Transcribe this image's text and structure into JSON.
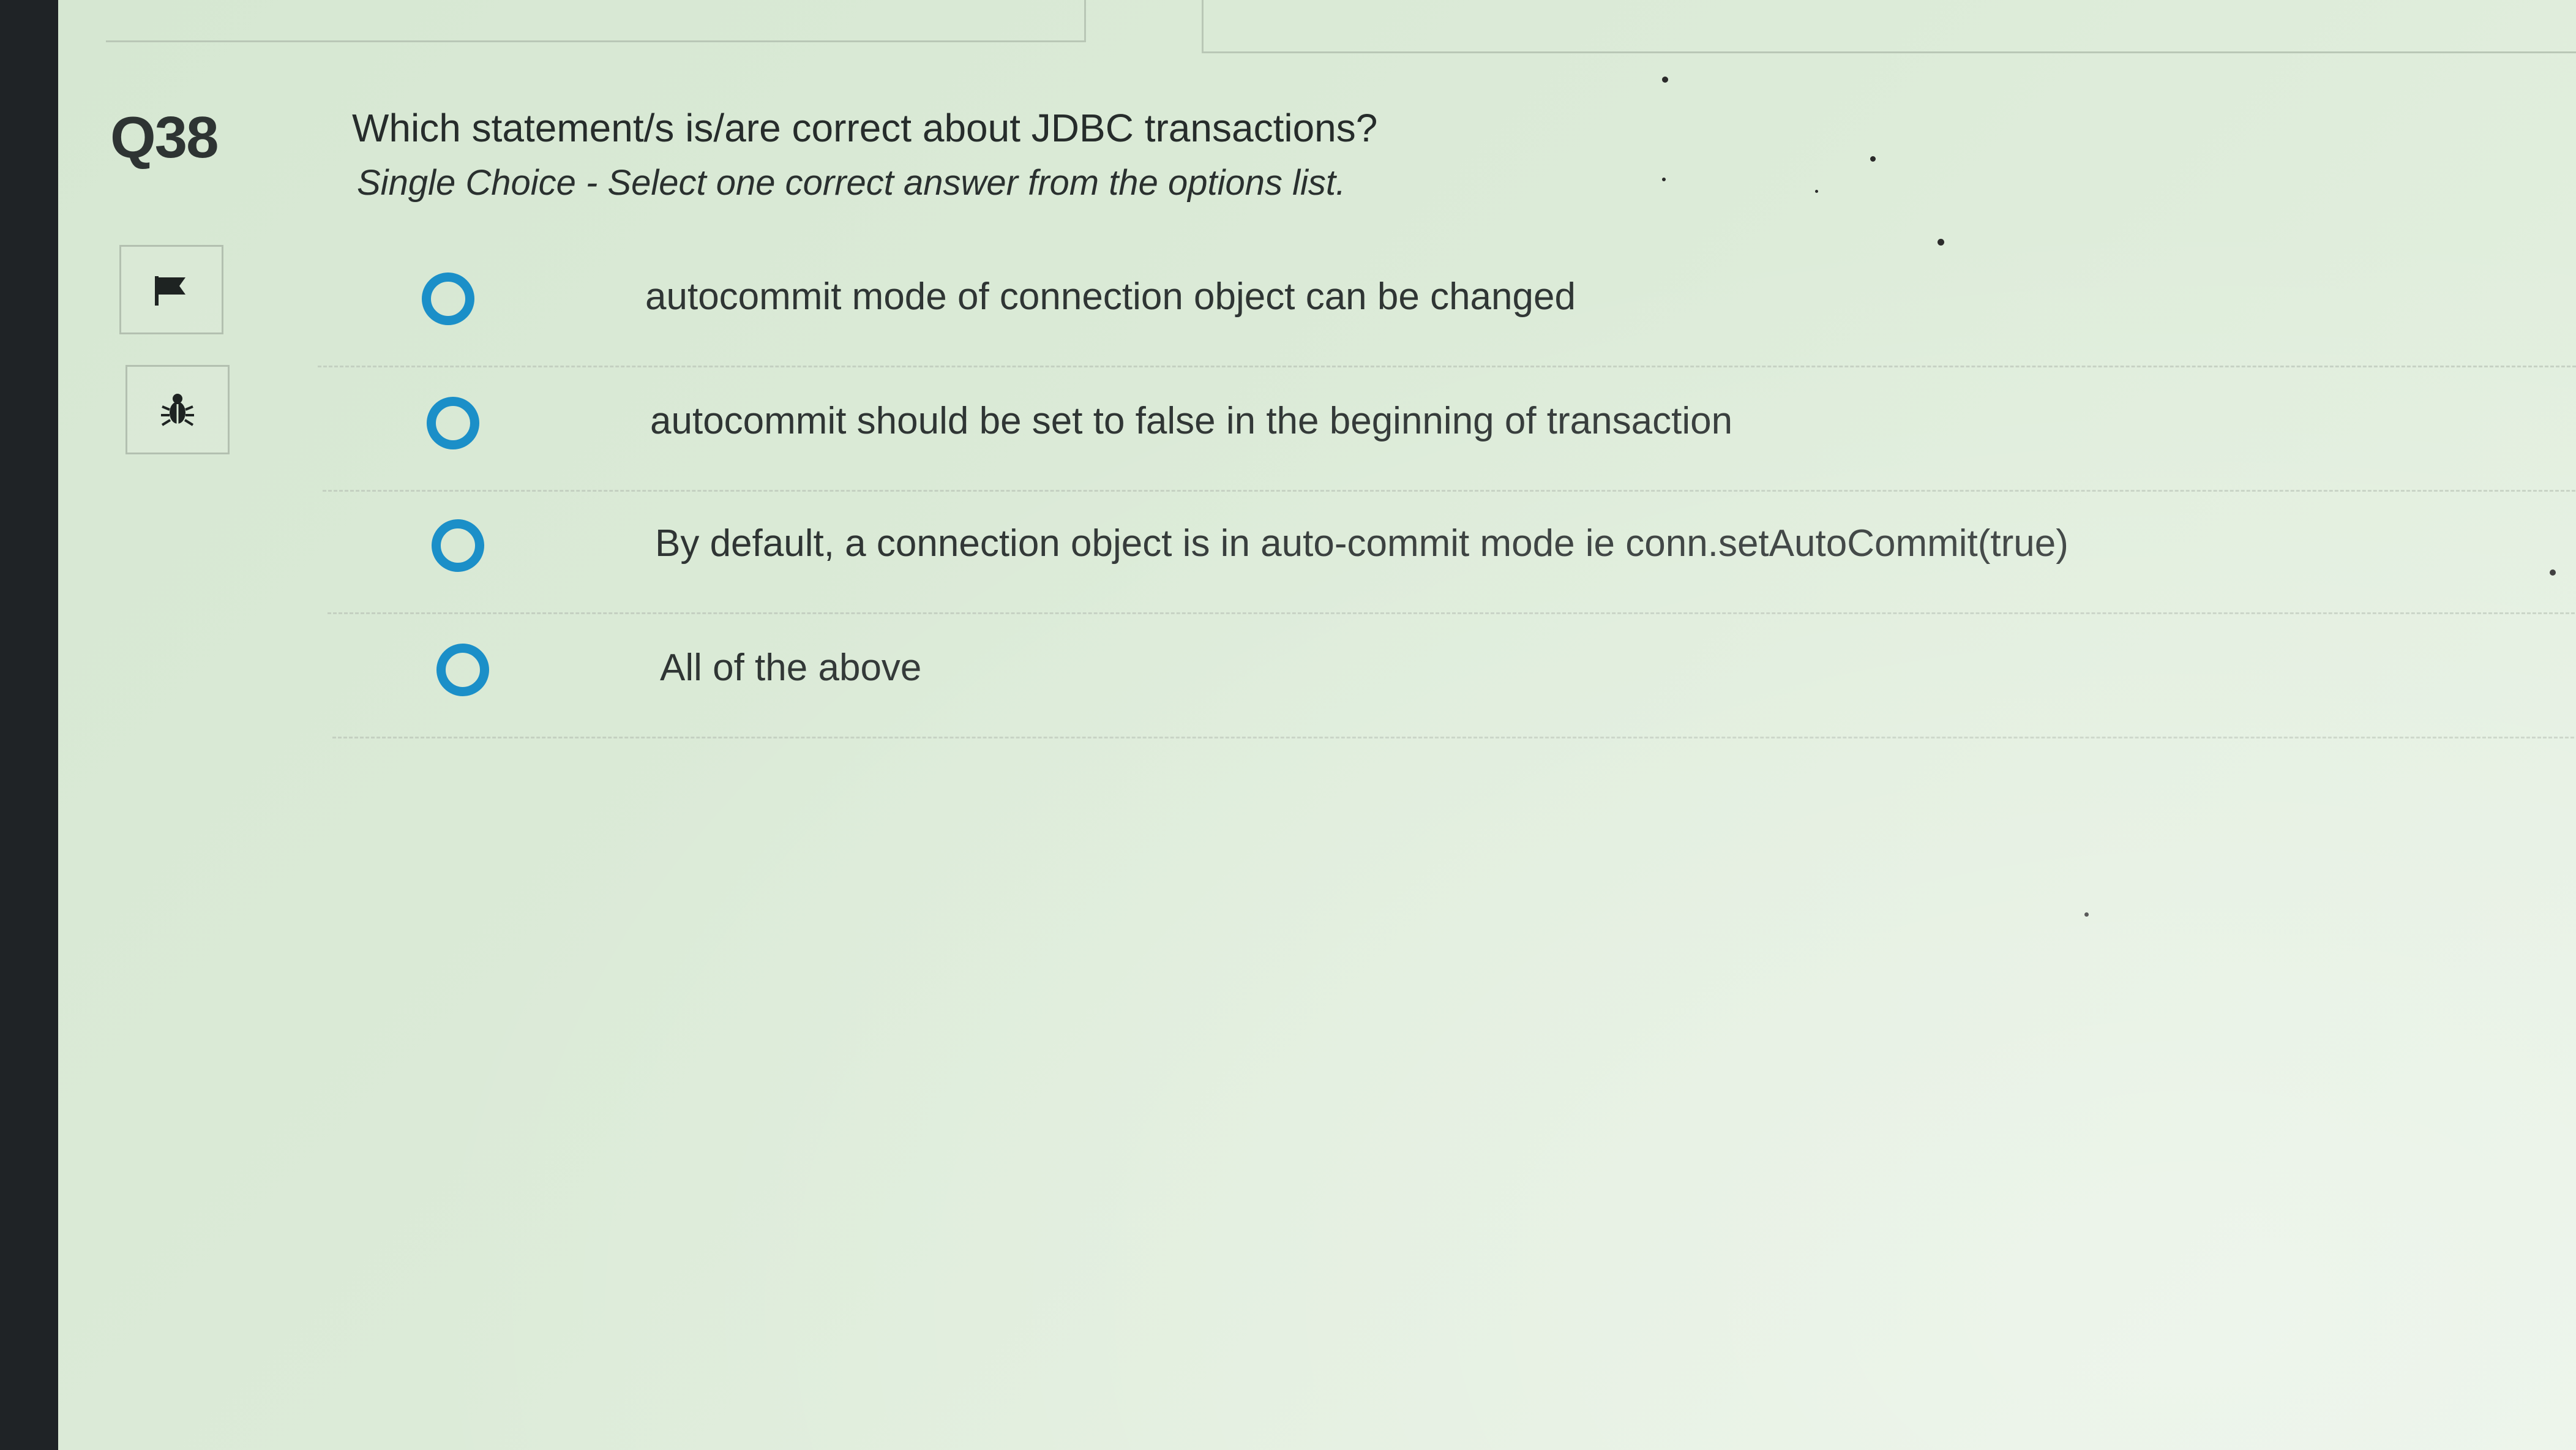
{
  "question": {
    "number": "Q38",
    "text": "Which statement/s is/are correct about JDBC transactions?",
    "instruction": "Single Choice - Select one correct answer from the options list.",
    "options": [
      {
        "label": "autocommit mode of connection object can be changed",
        "selected": false
      },
      {
        "label": "autocommit should be set to false in the beginning of transaction",
        "selected": false
      },
      {
        "label": "By default, a connection object is in auto-commit mode ie conn.setAutoCommit(true)",
        "selected": false
      },
      {
        "label": "All of the above",
        "selected": false
      }
    ]
  },
  "tools": {
    "flag_icon": "flag-icon",
    "bug_icon": "bug-icon"
  },
  "colors": {
    "radio_accent": "#1b8fc8",
    "background": "#dcebd8",
    "text": "#2f3534"
  }
}
